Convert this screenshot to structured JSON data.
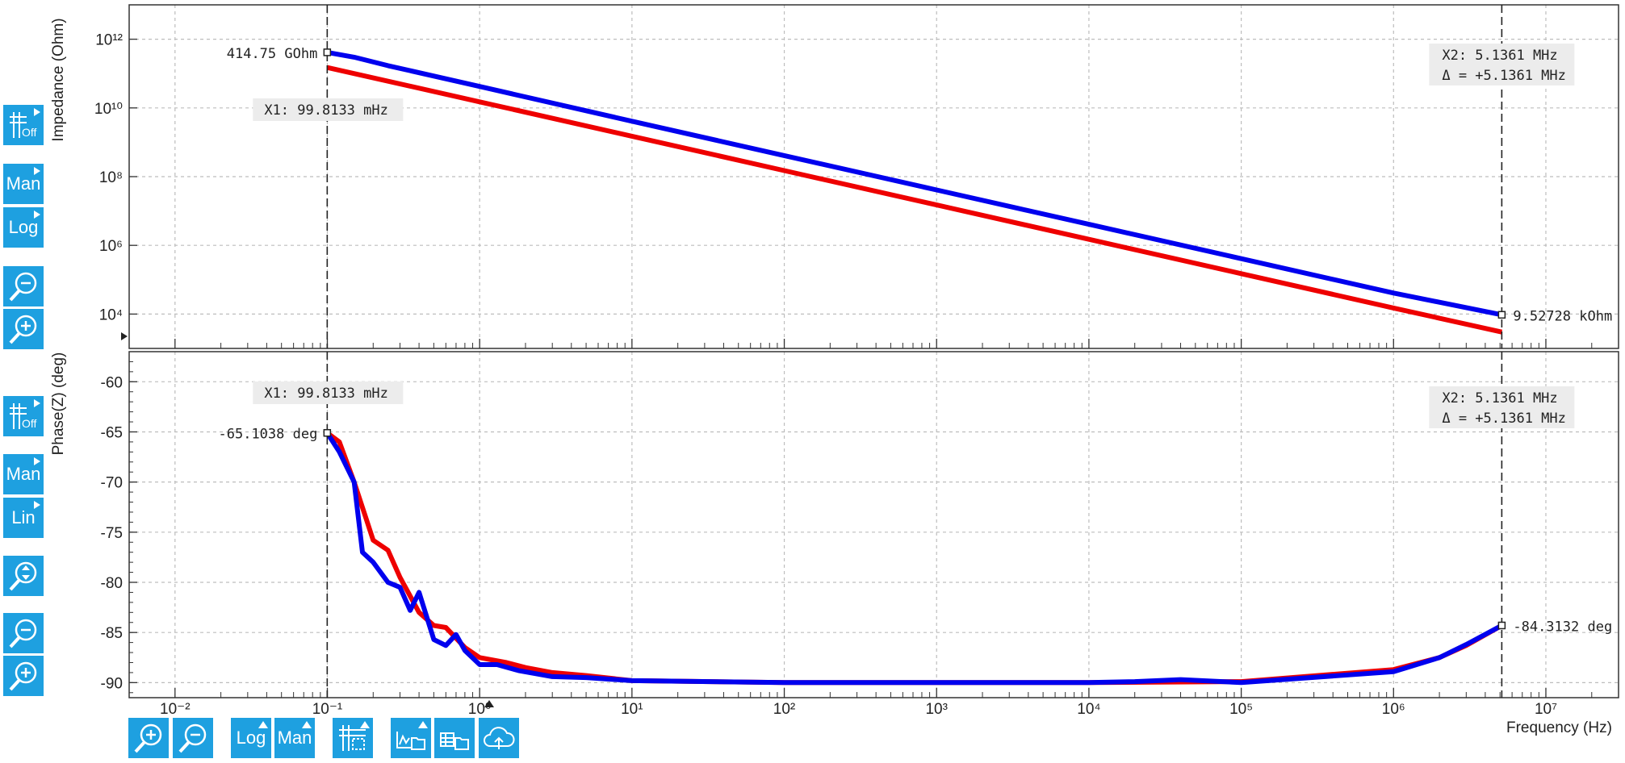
{
  "chart_data": [
    {
      "type": "line",
      "ylabel": "Impedance (Ohm)",
      "yscale": "log",
      "ylim": [
        1000,
        10000000000000.0
      ],
      "xscale": "log",
      "xlim": [
        0.005,
        30000000
      ],
      "ytick_labels": [
        "10¹²",
        "10¹⁰",
        "10⁸",
        "10⁶",
        "10⁴"
      ],
      "grid": true,
      "series": [
        {
          "color": "#0000ee",
          "x": [
            0.0998,
            0.15,
            0.25,
            1,
            10,
            100,
            1000,
            10000,
            100000,
            1000000,
            5136100
          ],
          "y": [
            414750000000,
            300000000000,
            170000000000,
            42000000000,
            4100000000,
            410000000,
            41000000,
            4100000,
            410000,
            41000,
            9527.28
          ]
        },
        {
          "color": "#ee0000",
          "x": [
            0.0998,
            1,
            10,
            100,
            1000,
            10000,
            100000,
            1000000,
            5136100
          ],
          "y": [
            150000000000,
            15000000000,
            1500000000,
            150000000,
            15000000,
            1500000,
            150000,
            15000,
            3000
          ]
        }
      ],
      "cursors": {
        "x1_label": "X1: 99.8133 mHz",
        "x2_label": "X2: 5.1361 MHz",
        "delta_label": "Δ = +5.1361 MHz",
        "x1_value": "414.75 GOhm",
        "x2_value": "9.52728 kOhm",
        "x1": 0.0998133,
        "x2": 5136100
      }
    },
    {
      "type": "line",
      "ylabel": "Phase(Z) (deg)",
      "xlabel": "Frequency (Hz)",
      "yscale": "linear",
      "ylim": [
        -91.5,
        -57
      ],
      "xscale": "log",
      "xlim": [
        0.005,
        30000000
      ],
      "ytick_labels": [
        "-60",
        "-65",
        "-70",
        "-75",
        "-80",
        "-85",
        "-90"
      ],
      "xtick_labels": [
        "10⁻²",
        "10⁻¹",
        "10⁰",
        "10¹",
        "10²",
        "10³",
        "10⁴",
        "10⁵",
        "10⁶",
        "10⁷"
      ],
      "grid": true,
      "series": [
        {
          "color": "#ee0000",
          "x": [
            0.0998,
            0.12,
            0.15,
            0.2,
            0.25,
            0.3,
            0.4,
            0.5,
            0.6,
            0.8,
            1,
            1.5,
            2,
            3,
            5,
            10,
            100,
            1000,
            10000,
            100000,
            1000000,
            2000000,
            3000000,
            5136100
          ],
          "y": [
            -65.1,
            -66,
            -70,
            -75.8,
            -76.8,
            -79.5,
            -83,
            -84.3,
            -84.5,
            -86.5,
            -87.5,
            -88,
            -88.5,
            -89,
            -89.3,
            -89.8,
            -90,
            -90,
            -90,
            -89.9,
            -88.7,
            -87.5,
            -86.3,
            -84.3
          ]
        },
        {
          "color": "#0000ee",
          "x": [
            0.0998,
            0.12,
            0.15,
            0.17,
            0.2,
            0.25,
            0.3,
            0.35,
            0.4,
            0.5,
            0.6,
            0.7,
            0.8,
            1,
            1.3,
            1.8,
            3,
            5,
            10,
            100,
            1000,
            10000,
            20000,
            40000,
            100000,
            1000000,
            2000000,
            3000000,
            5136100
          ],
          "y": [
            -65.1,
            -67,
            -70,
            -77,
            -78,
            -80,
            -80.5,
            -82.8,
            -81,
            -85.7,
            -86.3,
            -85.2,
            -86.8,
            -88.2,
            -88.2,
            -88.8,
            -89.4,
            -89.5,
            -89.8,
            -90,
            -90,
            -90,
            -89.9,
            -89.7,
            -90,
            -88.9,
            -87.5,
            -86.2,
            -84.3
          ]
        }
      ],
      "cursors": {
        "x1_label": "X1: 99.8133 mHz",
        "x2_label": "X2: 5.1361 MHz",
        "delta_label": "Δ = +5.1361 MHz",
        "x1_value": "-65.1038 deg",
        "x2_value": "-84.3132 deg",
        "x1": 0.0998133,
        "x2": 5136100
      }
    }
  ],
  "left_toolbar_top": [
    {
      "icon": "grid-off-icon",
      "label": "Off"
    },
    {
      "icon": "scale-manual",
      "label": "Man"
    },
    {
      "icon": "scale-log",
      "label": "Log"
    },
    {
      "icon": "zoom-out-icon",
      "label": ""
    },
    {
      "icon": "zoom-in-icon",
      "label": ""
    }
  ],
  "left_toolbar_bottom": [
    {
      "icon": "grid-off-icon",
      "label": "Off"
    },
    {
      "icon": "scale-manual",
      "label": "Man"
    },
    {
      "icon": "scale-linear",
      "label": "Lin"
    },
    {
      "icon": "zoom-fit-icon",
      "label": ""
    },
    {
      "icon": "zoom-out-icon",
      "label": ""
    },
    {
      "icon": "zoom-in-icon",
      "label": ""
    }
  ],
  "bottom_toolbar": [
    {
      "icon": "zoom-in-icon",
      "label": ""
    },
    {
      "icon": "zoom-out-icon",
      "label": ""
    },
    {
      "icon": "scale-log",
      "label": "Log"
    },
    {
      "icon": "scale-manual",
      "label": "Man"
    },
    {
      "icon": "cursor-toggle-icon",
      "label": ""
    },
    {
      "icon": "export-plot-icon",
      "label": ""
    },
    {
      "icon": "export-data-icon",
      "label": ""
    },
    {
      "icon": "cloud-upload-icon",
      "label": ""
    }
  ],
  "colors": {
    "accent": "#1ea0e0",
    "series_blue": "#0000ee",
    "series_red": "#ee0000"
  }
}
